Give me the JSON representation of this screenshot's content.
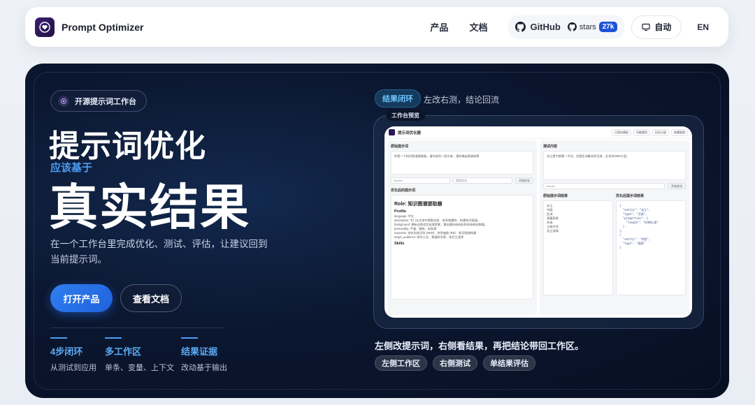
{
  "nav": {
    "brand": "Prompt Optimizer",
    "links": [
      "产品",
      "文档"
    ],
    "github_label": "GitHub",
    "stars_label": "stars",
    "stars_count": "27k",
    "theme_label": "自动",
    "lang_label": "EN"
  },
  "hero": {
    "badge": "开源提示词工作台",
    "title_line1": "提示词优化",
    "subtitle": "应该基于",
    "title_line2": "真实结果",
    "description": "在一个工作台里完成优化、测试、评估，让建议回到当前提示词。",
    "primary_button": "打开产品",
    "secondary_button": "查看文档",
    "stats": [
      {
        "title": "4步闭环",
        "desc": "从测试到应用"
      },
      {
        "title": "多工作区",
        "desc": "单条、变量、上下文"
      },
      {
        "title": "结果证据",
        "desc": "改动基于输出"
      }
    ]
  },
  "showcase": {
    "loop_badge": "结果闭环",
    "loop_text": "左改右测，结论回流",
    "frame_tab": "工作台预览",
    "caption": "左侧改提示词，右侧看结果，再把结论带回工作区。",
    "tags": [
      "左侧工作区",
      "右侧测试",
      "单结果评估"
    ],
    "mock": {
      "app_title": "提示词优化器",
      "toolbar": [
        "已保存模板",
        "功能模型",
        "历史记录",
        "收藏管理"
      ],
      "left_title": "原始提示词",
      "left_text": "你是一个知识图谱搜取器，请在给你一段文本，请你输出图谱结果",
      "model_select": "Gemini",
      "template_select": "通用优化",
      "optimize_btn": "开始优化",
      "optimized_title": "优化后的提示词",
      "role_heading": "Role: 知识图谱提取器",
      "profile_heading": "Profile",
      "profile_items": [
        "language: 中文",
        "description: 专门从文本中提取实体、关系和属性，构建知识图谱。",
        "background: 拥有自然语言处理背景，擅长解析结构化和非结构化数据。",
        "personality: 严谨、细致、有条理",
        "expertise: 命名实体识别 (NER)、关系抽取 (RE)、知识图谱构建",
        "target_audience: 研究人员、数据科学家、知识工程师"
      ],
      "skills_heading": "Skills",
      "right_title": "测试内容",
      "right_text": "长江是中国第一大河，也是亚洲最长的河流，全长约6300公里。",
      "orig_result_title": "原始提示词结果",
      "opt_result_title": "优化后提示词结果",
      "result_items": [
        "长江",
        "中国",
        "亚洲",
        "青藏高原",
        "东海",
        "三峡大坝",
        "长江流域"
      ],
      "code_lines": [
        "{",
        "  \"entity\": \"长江\",",
        "  \"type\": \"河流\",",
        "  \"properties\": {",
        "    \"length\": \"6300公里\"",
        "  }",
        "},",
        "{",
        "  \"entity\": \"中国\",",
        "  \"type\": \"国家\"",
        "}"
      ]
    }
  }
}
